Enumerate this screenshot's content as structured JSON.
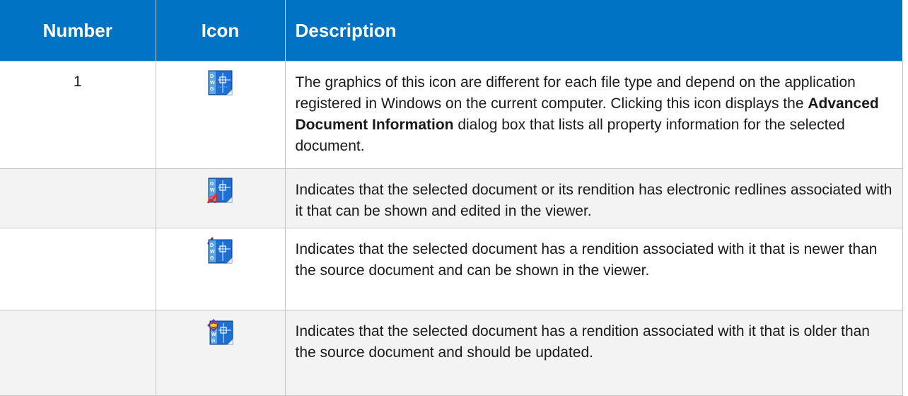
{
  "table": {
    "headers": {
      "number": "Number",
      "icon": "Icon",
      "description": "Description"
    },
    "rows": [
      {
        "number": "1",
        "icon": "dwg-file-icon",
        "description_pre": "The graphics of this icon are different for each file type and depend on the application registered in Windows on the current computer. Clicking this icon displays the ",
        "description_bold": "Advanced Document Information",
        "description_post": " dialog box that lists all property information for the selected document."
      },
      {
        "number": "",
        "icon": "dwg-redline-icon",
        "description": "Indicates that the selected document or its rendition has electronic redlines associated with it that can be shown and edited in the viewer."
      },
      {
        "number": "",
        "icon": "dwg-newer-rendition-icon",
        "description": "Indicates that the selected document has a rendition associated with it that is newer than the source document and can be shown in the viewer."
      },
      {
        "number": "",
        "icon": "dwg-older-rendition-icon",
        "description": "Indicates that the selected document has a rendition associated with it that is older than the source document and should be updated."
      }
    ]
  },
  "colors": {
    "header_bg": "#0073c4",
    "header_text": "#ffffff",
    "alt_row_bg": "#f3f3f3",
    "border": "#c6c6c6",
    "icon_blue": "#1e6fd0",
    "redline": "#d42a2a",
    "sync_yellow": "#f2d21a",
    "sync_purple": "#7a3aa8"
  }
}
